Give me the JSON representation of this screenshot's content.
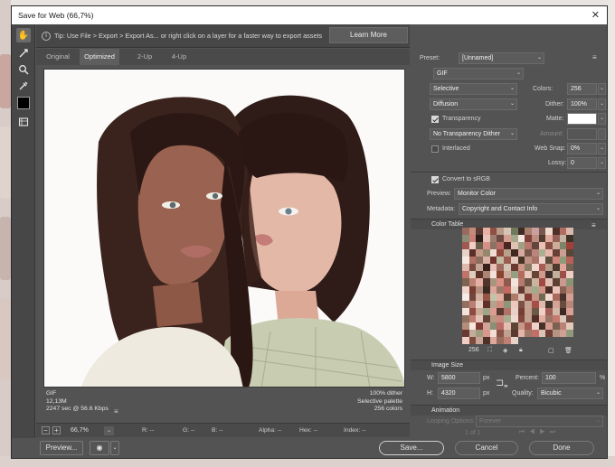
{
  "window": {
    "title": "Save for Web (66,7%)"
  },
  "tip": {
    "text": "Tip: Use File > Export > Export As...  or right click on a layer for a faster way to export assets",
    "learn_more": "Learn More"
  },
  "tabs": [
    "Original",
    "Optimized",
    "2-Up",
    "4-Up"
  ],
  "selected_tab": "Optimized",
  "image_info": {
    "format": "GIF",
    "size": "12,13M",
    "time": "2247 sec @ 56.6 Kbps",
    "dither": "100% dither",
    "palette": "Selective palette",
    "colors": "256 colors",
    "menu_icon": "≡"
  },
  "status": {
    "zoom": "66,7%",
    "r": "R: --",
    "g": "G: --",
    "b": "B: --",
    "alpha": "Alpha: --",
    "hex": "Hex: --",
    "index": "Index: --"
  },
  "buttons": {
    "preview": "Preview...",
    "save": "Save...",
    "cancel": "Cancel",
    "done": "Done"
  },
  "settings": {
    "preset_label": "Preset:",
    "preset_value": "[Unnamed]",
    "format": "GIF",
    "reduction": "Selective",
    "dither_algo": "Diffusion",
    "transparency_label": "Transparency",
    "transparency_checked": true,
    "trans_dither": "No Transparency Dither",
    "interlaced_label": "Interlaced",
    "interlaced_checked": false,
    "colors_label": "Colors:",
    "colors_value": "256",
    "dither_label": "Dither:",
    "dither_value": "100%",
    "matte_label": "Matte:",
    "matte_color": "#ffffff",
    "amount_label": "Amount:",
    "websnap_label": "Web Snap:",
    "websnap_value": "0%",
    "lossy_label": "Lossy:",
    "lossy_value": "0",
    "convert_srgb_label": "Convert to sRGB",
    "convert_srgb_checked": true,
    "preview_label": "Preview:",
    "preview_value": "Monitor Color",
    "metadata_label": "Metadata:",
    "metadata_value": "Copyright and Contact Info"
  },
  "color_table": {
    "title": "Color Table",
    "count": "256",
    "colors": [
      "#9a6a5e",
      "#c48a7c",
      "#5b3b34",
      "#e6b2a4",
      "#8e5044",
      "#b89a88",
      "#d7c4b6",
      "#6e7a5a",
      "#3e2a26",
      "#a77f6b",
      "#cba0a0",
      "#7a5650",
      "#efd8cc",
      "#4f3029",
      "#b06d62",
      "#dcb7ab",
      "#8a8c76",
      "#c97f75",
      "#2e1c18",
      "#e8c3b8",
      "#9c7d6e",
      "#6b4a42",
      "#d49d90",
      "#a5a88c",
      "#f4e6de",
      "#7e3f38",
      "#bd8e7f",
      "#513b30",
      "#e2a99d",
      "#94615a",
      "#c7b3a2",
      "#3f3327",
      "#a15852",
      "#f0cfc4",
      "#6a5f4b",
      "#d88f86",
      "#8b7262",
      "#ba6c68",
      "#4a2521",
      "#dfc2b1",
      "#9ea084",
      "#b9776d",
      "#63463b",
      "#edc0b5",
      "#865044",
      "#cfac9a",
      "#7d8569",
      "#a23f3b",
      "#e5d4c5",
      "#5a2f2a",
      "#c49787",
      "#93876e",
      "#f2dcd3",
      "#8f493f",
      "#ba9f8b",
      "#42291f",
      "#d6aa9e",
      "#77574a",
      "#bc857b",
      "#a9b092",
      "#e9b5aa",
      "#694035",
      "#caa093",
      "#574535",
      "#f6e9e2",
      "#b07166",
      "#8c6c5c",
      "#d9b2a4",
      "#70342f",
      "#c2bba3",
      "#9b5d4f",
      "#e4c7bb",
      "#473224",
      "#bf9184",
      "#a77466",
      "#ecd2c9",
      "#5e4c3c",
      "#d0867c",
      "#8f9a7a",
      "#b76057",
      "#dfb8ae",
      "#7a4a3e",
      "#c5a595",
      "#39211d",
      "#e8bfb4",
      "#9e6c60",
      "#d4c2b2",
      "#6a3a30",
      "#cb9588",
      "#8d7b63",
      "#f1d6cd",
      "#a95c53",
      "#b99c89",
      "#4c3a2c",
      "#e0a49a",
      "#76604f",
      "#c0746b",
      "#dccfbe",
      "#5c3329",
      "#aa8574",
      "#f3e0d8",
      "#85452f",
      "#cda89b",
      "#969f81",
      "#b56a60",
      "#e7c9bd",
      "#664537",
      "#d2998c",
      "#43302b",
      "#c0b09c",
      "#9a4f47",
      "#efcfc5",
      "#7d6451",
      "#bd8275",
      "#e4b0a5",
      "#51352b",
      "#a9957e",
      "#d78f86",
      "#8e5a4c",
      "#f5e4dc",
      "#b47a6e",
      "#6f5545",
      "#cab39f",
      "#a04844",
      "#e0bdb1",
      "#5d4234",
      "#c99a8d",
      "#8a9473",
      "#f0d4ca",
      "#783c33",
      "#b38e7c",
      "#3b2a22",
      "#dda69b",
      "#9b7868",
      "#c7695f",
      "#e9d6cb",
      "#623a31",
      "#bf9f8e",
      "#a2aa8c",
      "#d49387",
      "#4d2e26",
      "#eac4b9",
      "#8a6252",
      "#b78473",
      "#f7ebe5",
      "#71463c",
      "#d0b19f",
      "#995246",
      "#c1c4a8",
      "#e3afa3",
      "#573d30",
      "#ae7b6b",
      "#dbc1b3",
      "#803d35",
      "#c79485",
      "#6f6a54",
      "#f2d8ce",
      "#a96b60",
      "#4a342a",
      "#d69f93",
      "#93705f",
      "#bb7f76",
      "#e6cdc1",
      "#5f3128",
      "#b4a18e",
      "#cc8d80",
      "#8e9578",
      "#edc8bd",
      "#7a5245",
      "#c3a292",
      "#a64e48",
      "#e1b9ad",
      "#46362b",
      "#d3a497",
      "#6a4c3e",
      "#b9877a",
      "#f4e3db",
      "#8d4a41",
      "#caa997",
      "#9fa487",
      "#de9b91",
      "#5a3a31",
      "#b17367",
      "#e8d1c7",
      "#763f35",
      "#c59e8f",
      "#6b5846",
      "#f1d1c7",
      "#a35e55",
      "#d2b7a7",
      "#402a24",
      "#d9a195",
      "#90705e",
      "#be7b70",
      "#e4c4b8",
      "#634237",
      "#b89883",
      "#cb8b82",
      "#a7ad8f",
      "#efdad0",
      "#84463c",
      "#c0a08e",
      "#532f27",
      "#e2aea2",
      "#9a7565",
      "#c77970",
      "#ddc7b9",
      "#6d4a3e",
      "#b58d7b",
      "#f6e6de",
      "#7f3a33",
      "#d0a598",
      "#8b8f73",
      "#ba6d66",
      "#e6bdb2",
      "#5d4536",
      "#c69889",
      "#a45a51",
      "#ecd4ca",
      "#48302a",
      "#d49b90",
      "#7c6151",
      "#b98274",
      "#e1c9bc",
      "#6a3932",
      "#c3ad9a",
      "#9f9c7f",
      "#d9968d",
      "#f3ddd4",
      "#8c5447",
      "#bfa190",
      "#583a30",
      "#e5b4a9",
      "#a0786a",
      "#c26f67",
      "#dac3b6",
      "#713f37",
      "#b39582",
      "#cfa093",
      "#92997b",
      "#f0cec4",
      "#7b4b40",
      "#c8a496",
      "#4e3229",
      "#dea89d",
      "#986c5e",
      "#c07f75",
      "#e8d3c9"
    ]
  },
  "image_size": {
    "title": "Image Size",
    "w_label": "W:",
    "w_value": "5800",
    "w_unit": "px",
    "h_label": "H:",
    "h_value": "4320",
    "h_unit": "px",
    "percent_label": "Percent:",
    "percent_value": "100",
    "percent_unit": "%",
    "quality_label": "Quality:",
    "quality_value": "Bicubic"
  },
  "animation": {
    "title": "Animation",
    "looping_label": "Looping Options:",
    "looping_value": "Forever",
    "frame_counter": "1 of 1"
  }
}
